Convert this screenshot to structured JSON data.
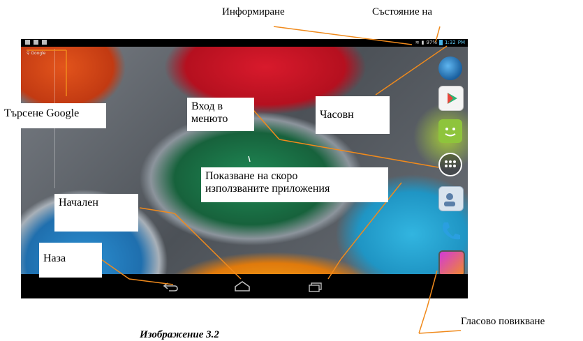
{
  "status_bar": {
    "battery": "97%",
    "time": "1:32",
    "ampm": "PM"
  },
  "google_search_hint": "Google",
  "annotations": {
    "information": "Информиране",
    "status": "Състояние на",
    "google_search": "Търсене Google",
    "clock": "Часовн",
    "menu_line1": "Вход в",
    "menu_line2": "менюто",
    "recent_line1": "Показване на скоро",
    "recent_line2": "използваните приложения",
    "home_label": "Начален",
    "back": "Наза",
    "voice_call": "Гласово повикване"
  },
  "figure_caption": "Изображение 3.2",
  "icons": {
    "dock": [
      "globe-icon",
      "play-store-icon",
      "messaging-icon",
      "app-drawer-icon",
      "contacts-icon",
      "phone-icon",
      "gallery-icon"
    ],
    "navbar": [
      "back-icon",
      "home-icon",
      "recent-apps-icon"
    ]
  },
  "colors": {
    "annotation_line": "#f08a1c",
    "status_bar": "#000000",
    "clock_accent": "#5fc8f0"
  }
}
